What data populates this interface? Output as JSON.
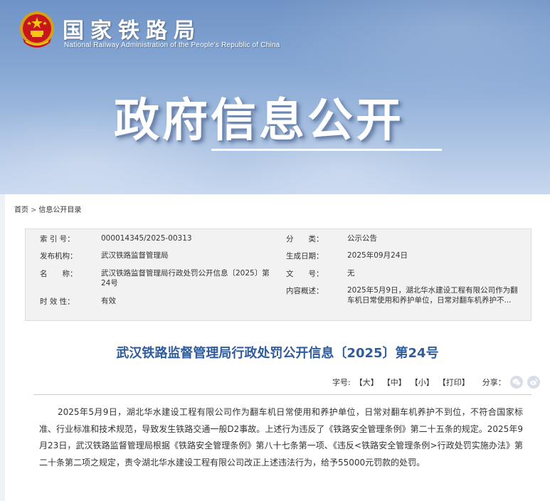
{
  "header": {
    "site_name": "国家铁路局",
    "site_name_en": "National Railway Administration of the People's Republic of China",
    "banner_title": "政府信息公开",
    "colors": {
      "title": "#2f5c9c",
      "banner": "#86a7d4"
    }
  },
  "breadcrumb": {
    "home": "首页",
    "separator": ">",
    "current": "信息公开目录"
  },
  "info": {
    "index_label": "索 引 号：",
    "index_value": "000014345/2025-00313",
    "category_label": "分　　类：",
    "category_value": "公示公告",
    "publisher_label": "发布机构：",
    "publisher_value": "武汉铁路监督管理局",
    "date_label": "生成日期：",
    "date_value": "2025年09月24日",
    "name_label": "名　　称：",
    "name_value": "武汉铁路监督管理局行政处罚公开信息〔2025〕第24号",
    "doc_no_label": "文　　号：",
    "doc_no_value": "无",
    "summary_label": "内容概述：",
    "summary_value": "2025年5月9日，湖北华水建设工程有限公司作为翻车机日常使用和养护单位，日常对翻车机养护不...",
    "validity_label": "时 效 性：",
    "validity_value": "有效"
  },
  "article": {
    "title": "武汉铁路监督管理局行政处罚公开信息〔2025〕第24号",
    "font_label": "字号:",
    "font_large": "【大】",
    "font_medium": "【中】",
    "font_small": "【小】",
    "print": "【打印】",
    "share_label": "分享：",
    "share_icons": [
      "wechat-icon",
      "weibo-icon"
    ],
    "body": "2025年5月9日，湖北华水建设工程有限公司作为翻车机日常使用和养护单位，日常对翻车机养护不到位，不符合国家标准、行业标准和技术规范，导致发生铁路交通一般D2事故。上述行为违反了《铁路安全管理条例》第二十五条的规定。2025年9月23日，武汉铁路监督管理局根据《铁路安全管理条例》第八十七条第一项、《违反<铁路安全管理条例>行政处罚实施办法》第二十条第二项之规定，责令湖北华水建设工程有限公司改正上述违法行为，给予55000元罚款的处罚。"
  }
}
